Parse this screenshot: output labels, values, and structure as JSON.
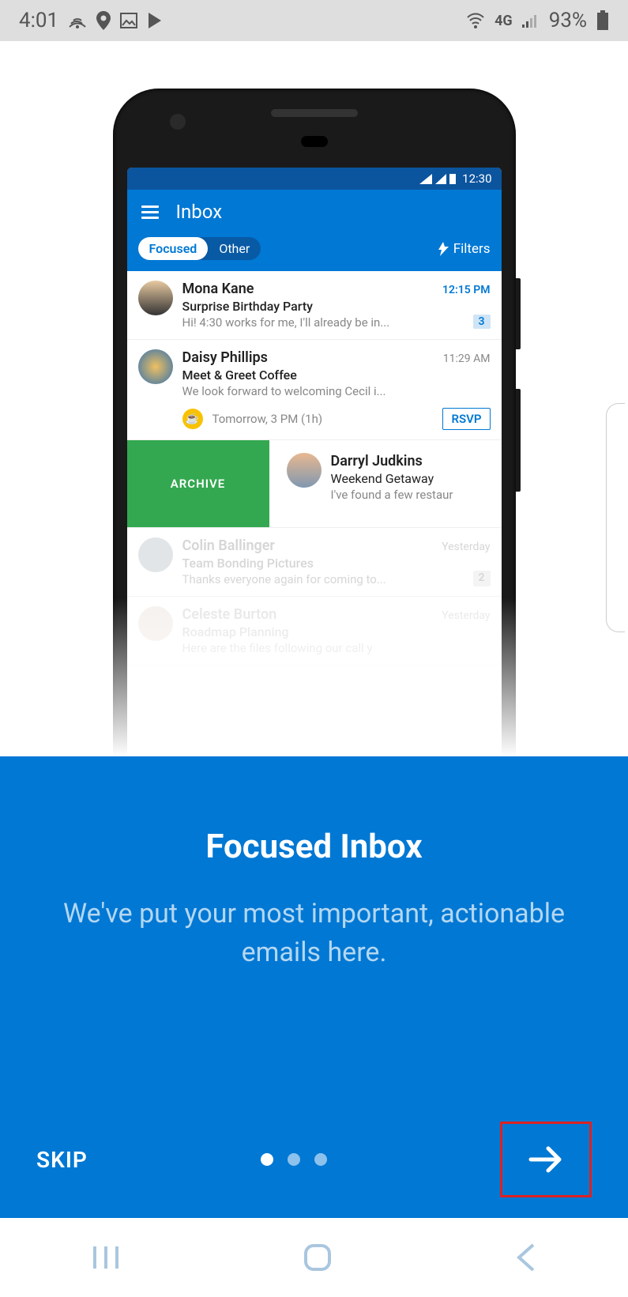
{
  "status_bar": {
    "time": "4:01",
    "battery": "93%",
    "network_label": "4G"
  },
  "mock": {
    "status_time": "12:30",
    "header": {
      "title": "Inbox",
      "tab_focused": "Focused",
      "tab_other": "Other",
      "filters": "Filters"
    },
    "emails": [
      {
        "sender": "Mona Kane",
        "time": "12:15 PM",
        "subject": "Surprise Birthday Party",
        "preview": "Hi! 4:30 works for me, I'll already be in...",
        "badge": "3"
      },
      {
        "sender": "Daisy Phillips",
        "time": "11:29 AM",
        "subject": "Meet & Greet Coffee",
        "preview": "We look forward to welcoming Cecil i...",
        "event_time": "Tomorrow, 3 PM (1h)",
        "rsvp": "RSVP"
      },
      {
        "sender": "Darryl Judkins",
        "subject": "Weekend Getaway",
        "preview": "I've found a few restaur",
        "archive_label": "ARCHIVE"
      },
      {
        "sender": "Colin Ballinger",
        "time": "Yesterday",
        "subject": "Team Bonding Pictures",
        "preview": "Thanks everyone again for coming to...",
        "badge": "2"
      },
      {
        "sender": "Celeste Burton",
        "time": "Yesterday",
        "subject": "Roadmap Planning",
        "preview": "Here are the files following our call y"
      }
    ]
  },
  "onboarding": {
    "title": "Focused Inbox",
    "subtitle": "We've put your most important, actionable emails here.",
    "skip": "SKIP",
    "page_count": 3,
    "active_page": 0
  }
}
